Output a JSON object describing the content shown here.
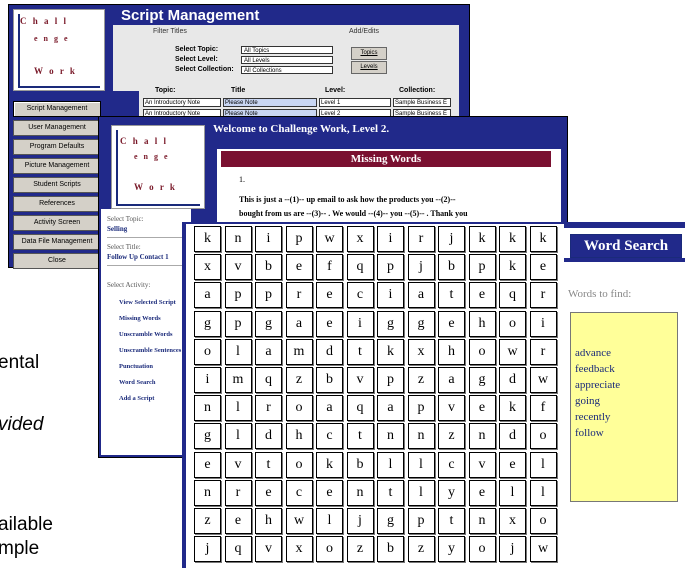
{
  "background_text": [
    "ental",
    "vided",
    "ailable",
    "mple"
  ],
  "w1": {
    "title": "Script Management",
    "logo": {
      "l1": "C h a l l",
      "l2": "e n g e",
      "l3": "W o r k"
    },
    "filter_titles": "Filter Titles",
    "add_edits": "Add/Edits",
    "select_topic_label": "Select Topic:",
    "select_level_label": "Select Level:",
    "select_collection_label": "Select Collection:",
    "select_topic_value": "All Topics",
    "select_level_value": "All Levels",
    "select_collection_value": "All Collections",
    "topics_btn": "Topics",
    "levels_btn": "Levels",
    "headers": {
      "topic": "Topic:",
      "title": "Title",
      "level": "Level:",
      "collection": "Collection:"
    },
    "rows": [
      {
        "topic": "An Introductory Note",
        "title": "Please Note",
        "level": "Level 1",
        "collection": "Sample Business E"
      },
      {
        "topic": "An Introductory Note",
        "title": "Please Note",
        "level": "Level 2",
        "collection": "Sample Business E"
      }
    ],
    "sidebar": [
      "Script Management",
      "User Management",
      "Program Defaults",
      "Picture Management",
      "Student Scripts",
      "References",
      "Activity Screen",
      "Data File Management",
      "Close"
    ]
  },
  "w2": {
    "title": "Welcome to Challenge Work, Level 2.",
    "heading": "Missing Words",
    "para_num": "1.",
    "para_l1": "This is just a --(1)-- up email to ask how the products you --(2)--",
    "para_l2": "bought from us are --(3)-- . We would --(4)-- you --(5)-- . Thank you",
    "select_topic_label": "Select Topic:",
    "select_topic_value": "Selling",
    "select_title_label": "Select Title:",
    "select_title_value": "Follow Up Contact 1",
    "select_activity_label": "Select Activity:",
    "activities": [
      "View Selected Script",
      "Missing Words",
      "Unscramble Words",
      "Unscramble Sentences",
      "Punctuation",
      "Word Search",
      "Add a Script"
    ]
  },
  "w3": {
    "heading": "Word Search",
    "words_to_find_label": "Words to find:",
    "words": [
      "advance",
      "feedback",
      "appreciate",
      "going",
      "recently",
      "follow"
    ],
    "grid": [
      [
        "k",
        "n",
        "i",
        "p",
        "w",
        "x",
        "i",
        "r",
        "j",
        "k",
        "k",
        "k"
      ],
      [
        "x",
        "v",
        "b",
        "e",
        "f",
        "q",
        "p",
        "j",
        "b",
        "p",
        "k",
        "e"
      ],
      [
        "a",
        "p",
        "p",
        "r",
        "e",
        "c",
        "i",
        "a",
        "t",
        "e",
        "q",
        "r"
      ],
      [
        "g",
        "p",
        "g",
        "a",
        "e",
        "i",
        "g",
        "g",
        "e",
        "h",
        "o",
        "i"
      ],
      [
        "o",
        "l",
        "a",
        "m",
        "d",
        "t",
        "k",
        "x",
        "h",
        "o",
        "w",
        "r"
      ],
      [
        "i",
        "m",
        "q",
        "z",
        "b",
        "v",
        "p",
        "z",
        "a",
        "g",
        "d",
        "w"
      ],
      [
        "n",
        "l",
        "r",
        "o",
        "a",
        "q",
        "a",
        "p",
        "v",
        "e",
        "k",
        "f"
      ],
      [
        "g",
        "l",
        "d",
        "h",
        "c",
        "t",
        "n",
        "n",
        "z",
        "n",
        "d",
        "o"
      ],
      [
        "e",
        "v",
        "t",
        "o",
        "k",
        "b",
        "l",
        "l",
        "c",
        "v",
        "e",
        "l"
      ],
      [
        "n",
        "r",
        "e",
        "c",
        "e",
        "n",
        "t",
        "l",
        "y",
        "e",
        "l",
        "l"
      ],
      [
        "z",
        "e",
        "h",
        "w",
        "l",
        "j",
        "g",
        "p",
        "t",
        "n",
        "x",
        "o"
      ],
      [
        "j",
        "q",
        "v",
        "x",
        "o",
        "z",
        "b",
        "z",
        "y",
        "o",
        "j",
        "w"
      ]
    ]
  }
}
